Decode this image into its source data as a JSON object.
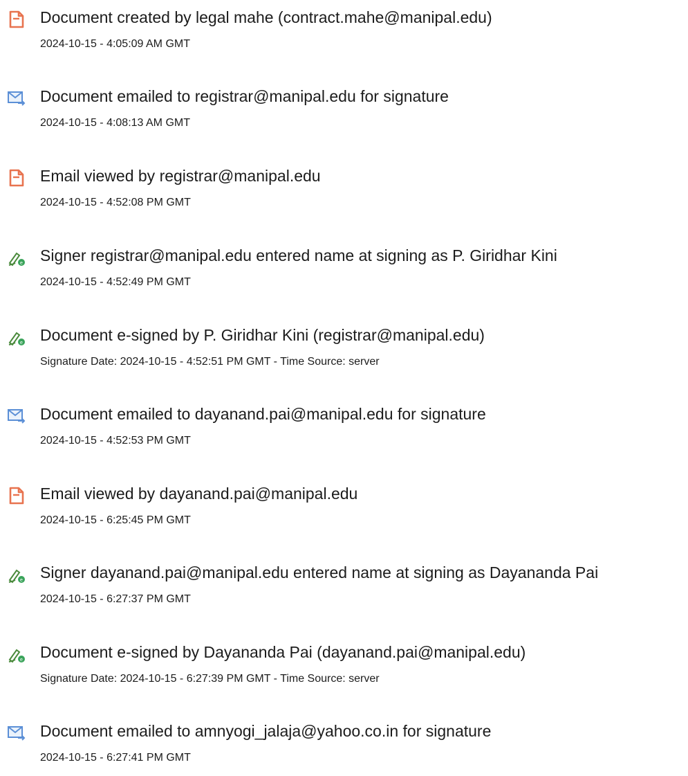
{
  "entries": [
    {
      "icon": "document-created-icon",
      "title": "Document created by legal mahe (contract.mahe@manipal.edu)",
      "sub": "2024-10-15 - 4:05:09 AM GMT"
    },
    {
      "icon": "email-sent-icon",
      "title": "Document emailed to registrar@manipal.edu for signature",
      "sub": "2024-10-15 - 4:08:13 AM GMT"
    },
    {
      "icon": "document-viewed-icon",
      "title": "Email viewed by registrar@manipal.edu",
      "sub": "2024-10-15 - 4:52:08 PM GMT"
    },
    {
      "icon": "e-sign-pen-icon",
      "title": "Signer registrar@manipal.edu entered name at signing as P. Giridhar Kini",
      "sub": "2024-10-15 - 4:52:49 PM GMT"
    },
    {
      "icon": "e-sign-pen-icon",
      "title": "Document e-signed by P. Giridhar Kini (registrar@manipal.edu)",
      "sub": "Signature Date: 2024-10-15 - 4:52:51 PM GMT - Time Source: server"
    },
    {
      "icon": "email-sent-icon",
      "title": "Document emailed to dayanand.pai@manipal.edu for signature",
      "sub": "2024-10-15 - 4:52:53 PM GMT"
    },
    {
      "icon": "document-viewed-icon",
      "title": "Email viewed by dayanand.pai@manipal.edu",
      "sub": "2024-10-15 - 6:25:45 PM GMT"
    },
    {
      "icon": "e-sign-pen-icon",
      "title": "Signer dayanand.pai@manipal.edu entered name at signing as Dayananda Pai",
      "sub": "2024-10-15 - 6:27:37 PM GMT"
    },
    {
      "icon": "e-sign-pen-icon",
      "title": "Document e-signed by Dayananda Pai (dayanand.pai@manipal.edu)",
      "sub": "Signature Date: 2024-10-15 - 6:27:39 PM GMT - Time Source: server"
    },
    {
      "icon": "email-sent-icon",
      "title": "Document emailed to amnyogi_jalaja@yahoo.co.in for signature",
      "sub": "2024-10-15 - 6:27:41 PM GMT"
    }
  ],
  "colors": {
    "document_icon": "#e8734f",
    "email_icon": "#5b8fd6",
    "sign_icon": "#4a8a3c",
    "sign_badge": "#3aa35a"
  }
}
